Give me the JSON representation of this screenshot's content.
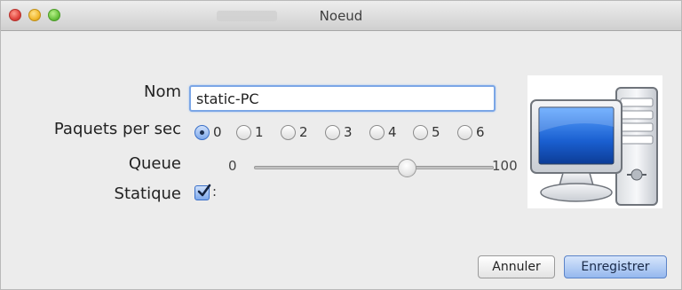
{
  "window": {
    "title": "Noeud"
  },
  "form": {
    "nom_label": "Nom",
    "nom_value": "static-PC",
    "paquets_label": "Paquets per sec",
    "paquets_options": [
      "0",
      "1",
      "2",
      "3",
      "4",
      "5",
      "6"
    ],
    "paquets_selected": "0",
    "queue_label": "Queue",
    "queue_min": "0",
    "queue_max": "100",
    "queue_value": 64,
    "statique_label": "Statique",
    "statique_checked": true,
    "statique_suffix": ":"
  },
  "image": {
    "icon": "desktop-computer-icon"
  },
  "buttons": {
    "cancel": "Annuler",
    "save": "Enregistrer"
  },
  "colors": {
    "accent": "#7ea9ec",
    "focus_ring": "#7ba6e6"
  }
}
